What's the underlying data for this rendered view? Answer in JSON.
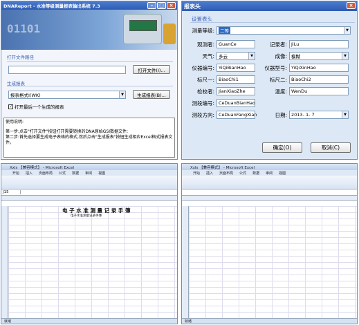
{
  "export_window": {
    "title": "DNAReport - 水准等级测量报表输出系统 7.3",
    "open_section": "打开文件路径",
    "open_path": "",
    "open_button": "打开文件(I)...",
    "gen_section": "生成报表",
    "format_selected": "报表格式I(WK)",
    "gen_button": "生成报表(B)...",
    "open_after_label": "打开最后一个生成的报表",
    "open_after_checked": true,
    "help_title": "使用说明:",
    "help_line1": "第一步:点击\"打开文件\"按钮打开需要转换的DNA原始GSI数据文件;",
    "help_line2": "第二步:首先选择要生成电子表格的格式,然后点击\"生成报表\"按钮生成相应Excel格式报表文件。"
  },
  "header_dialog": {
    "title": "报表头",
    "section": "设置表头",
    "level_label": "测量等级:",
    "level_value": "二等",
    "observer_label": "观测者:",
    "observer_value": "GuanCe",
    "recorder_label": "记录者:",
    "recorder_value": "JiLu",
    "weather_label": "天气:",
    "weather_value": "多云",
    "imaging_label": "成像:",
    "imaging_value": "模糊",
    "instr_no_label": "仪器编号:",
    "instr_no_value": "YiQiBianHao",
    "instr_model_label": "仪器型号:",
    "instr_model_value": "YiQiXinHao",
    "staff1_label": "标尺一:",
    "staff1_value": "BiaoChi1",
    "staff2_label": "标尺二:",
    "staff2_value": "BiaoChi2",
    "checker_label": "检校者:",
    "checker_value": "JianXiaoZhe",
    "temp_label": "温度:",
    "temp_value": "WenDu",
    "segno_label": "测段编号:",
    "segno_value": "CeDuanBianHao",
    "segdir_label": "测段方向:",
    "segdir_value": "CeDuanFangXian",
    "date_label": "日期:",
    "date_value": "2013- 1- 7",
    "ok_button": "确定(O)",
    "cancel_button": "取消(C)"
  },
  "excel_left": {
    "title": "Xxls 【兼容模式】 - Microsoft Excel",
    "menus": [
      "开始",
      "插入",
      "页面布局",
      "公式",
      "数据",
      "审阅",
      "视图"
    ],
    "namebox": "J15",
    "heading": "电 子 水 准 测 量 记 录 手 簿",
    "subheading": "电子水准测量记录手簿",
    "status": "就绪"
  },
  "excel_right": {
    "title": "Xxls 【兼容模式】 - Microsoft Excel",
    "menus": [
      "开始",
      "插入",
      "页面布局",
      "公式",
      "数据",
      "审阅",
      "视图"
    ],
    "namebox": "",
    "status": "就绪"
  }
}
